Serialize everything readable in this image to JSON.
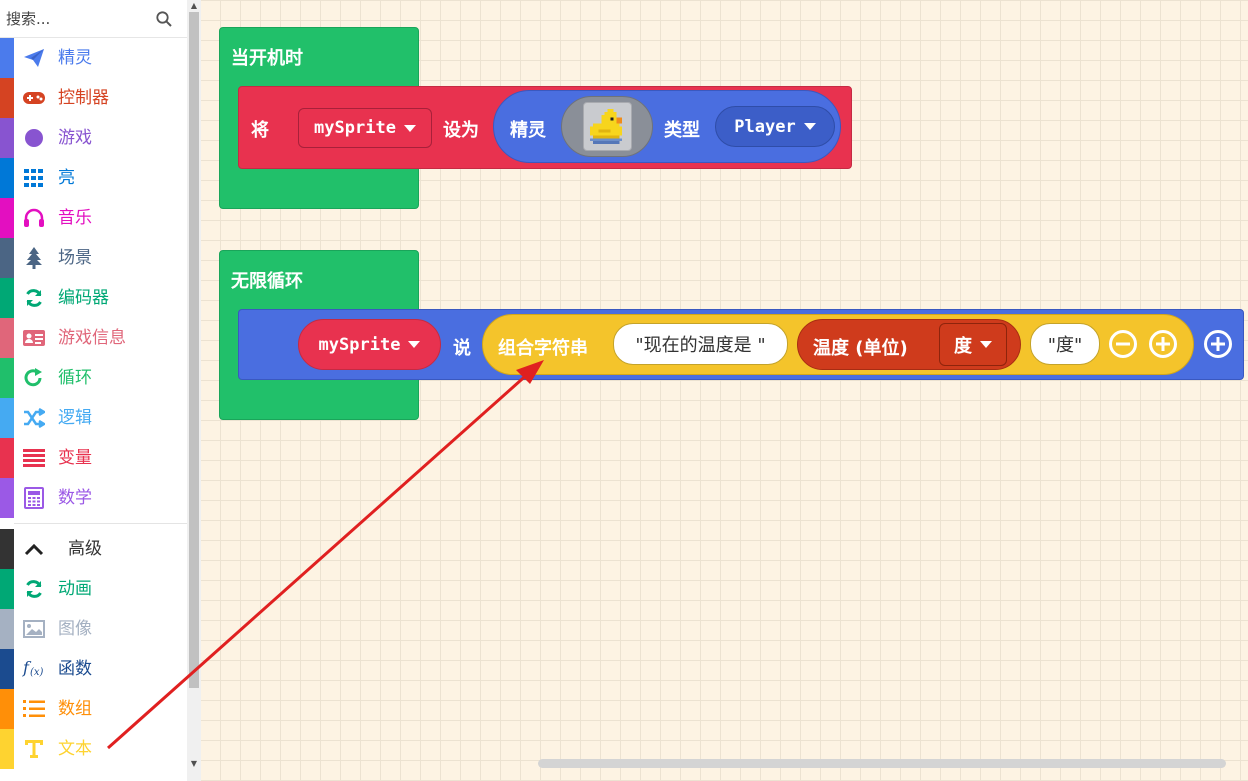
{
  "search": {
    "placeholder": "搜索..."
  },
  "toolbox": {
    "categories": [
      {
        "label": "精灵",
        "color": "#4b7bec",
        "icon": "paper-plane-icon"
      },
      {
        "label": "控制器",
        "color": "#d54322",
        "icon": "gamepad-icon"
      },
      {
        "label": "游戏",
        "color": "#8854d0",
        "icon": "circle-icon"
      },
      {
        "label": "亮",
        "color": "#0078d7",
        "icon": "grid-icon"
      },
      {
        "label": "音乐",
        "color": "#e30fc0",
        "icon": "headphones-icon"
      },
      {
        "label": "场景",
        "color": "#4b6584",
        "icon": "tree-icon"
      },
      {
        "label": "编码器",
        "color": "#00a875",
        "icon": "refresh-icon"
      },
      {
        "label": "游戏信息",
        "color": "#e0667a",
        "icon": "id-card-icon"
      },
      {
        "label": "循环",
        "color": "#20bf6b",
        "icon": "loop-icon"
      },
      {
        "label": "逻辑",
        "color": "#45aaf2",
        "icon": "shuffle-icon"
      },
      {
        "label": "变量",
        "color": "#e8324f",
        "icon": "list-lines-icon"
      },
      {
        "label": "数学",
        "color": "#9b59e6",
        "icon": "calculator-icon"
      }
    ],
    "advanced": {
      "label": "高级",
      "color": "#333333",
      "icon": "chevron-up-icon"
    },
    "advanced_categories": [
      {
        "label": "动画",
        "color": "#00a875",
        "icon": "refresh-icon"
      },
      {
        "label": "图像",
        "color": "#a5b1c2",
        "icon": "image-icon"
      },
      {
        "label": "函数",
        "color": "#1b4b8f",
        "icon": "function-icon"
      },
      {
        "label": "数组",
        "color": "#ff8f08",
        "icon": "numbered-list-icon"
      },
      {
        "label": "文本",
        "color": "#fed330",
        "icon": "text-icon"
      }
    ]
  },
  "workspace": {
    "on_start": {
      "label": "当开机时",
      "set_label": "将",
      "variable": "mySprite",
      "to_label": "设为",
      "sprite_label": "精灵",
      "kind_label": "类型",
      "kind_value": "Player"
    },
    "forever": {
      "label": "无限循环",
      "sprite_var": "mySprite",
      "say_label": "说",
      "join_label": "组合字符串",
      "string1": "\"现在的温度是 \"",
      "temp_label": "温度 (单位)",
      "temp_unit": "度",
      "string2": "\"度\""
    }
  },
  "colors": {
    "event_green": "#21c06a",
    "variable_red": "#e8324f",
    "sprite_blue": "#4a6ee0",
    "text_yellow": "#f4c42b",
    "sensor_orange": "#cf3b1c",
    "annotation_arrow": "#e02020"
  }
}
